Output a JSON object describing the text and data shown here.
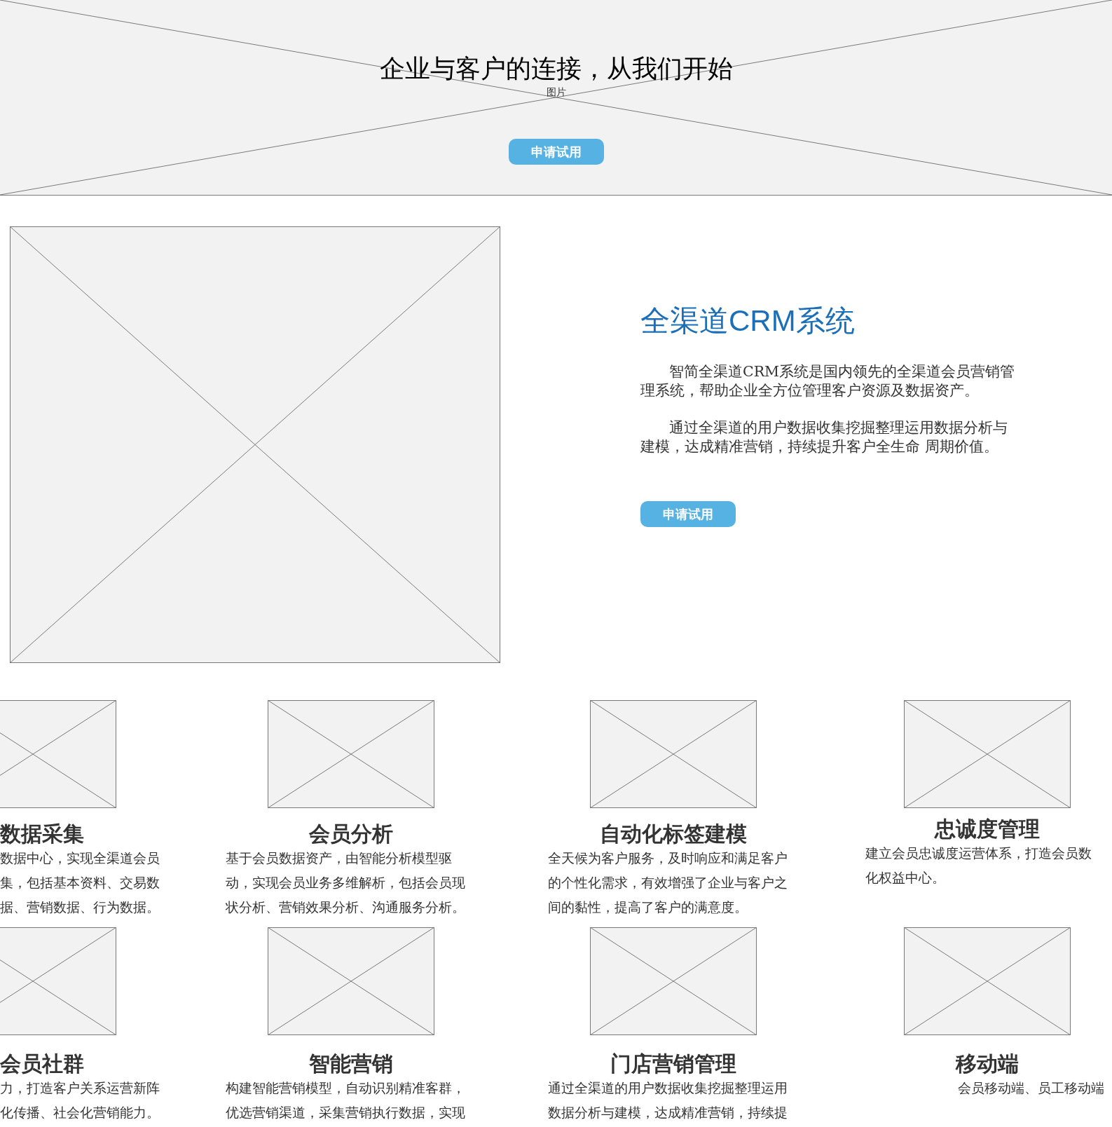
{
  "hero": {
    "title": "企业与客户的连接，从我们开始",
    "image_label": "图片",
    "button": "申请试用"
  },
  "intro": {
    "title": "全渠道CRM系统",
    "paragraphs": [
      "智简全渠道CRM系统是国内领先的全渠道会员营销管理系统，帮助企业全方位管理客户资源及数据资产。",
      "通过全渠道的用户数据收集挖掘整理运用数据分析与建模，达成精准营销，持续提升客户全生命 周期价值。"
    ],
    "button": "申请试用"
  },
  "feature_rows": [
    {
      "items": [
        {
          "title": "数据采集",
          "lines": [
            "数据中心，实现全渠道会员",
            "集，包括基本资料、交易数",
            "据、营销数据、行为数据。"
          ]
        },
        {
          "title": "会员分析",
          "lines": [
            "基于会员数据资产，由智能分析模型驱",
            "动，实现会员业务多维解析，包括会员现",
            "状分析、营销效果分析、沟通服务分析。"
          ]
        },
        {
          "title": "自动化标签建模",
          "lines": [
            "全天候为客户服务，及时响应和满足客户",
            "的个性化需求，有效增强了企业与客户之",
            "间的黏性，提高了客户的满意度。"
          ]
        },
        {
          "title": "忠诚度管理",
          "lines": [
            "建立会员忠诚度运营体系，打造会员数",
            "化权益中心。"
          ]
        }
      ]
    },
    {
      "items": [
        {
          "title": "会员社群",
          "lines": [
            "力，打造客户关系运营新阵",
            "化传播、社会化营销能力。"
          ]
        },
        {
          "title": "智能营销",
          "lines": [
            "构建智能营销模型，自动识别精准客群，",
            "优选营销渠道，采集营销执行数据，实现"
          ]
        },
        {
          "title": "门店营销管理",
          "lines": [
            "通过全渠道的用户数据收集挖掘整理运用",
            "数据分析与建模，达成精准营销，持续提"
          ]
        },
        {
          "title": "移动端",
          "lines": [
            "会员移动端、员工移动端"
          ]
        }
      ]
    }
  ]
}
